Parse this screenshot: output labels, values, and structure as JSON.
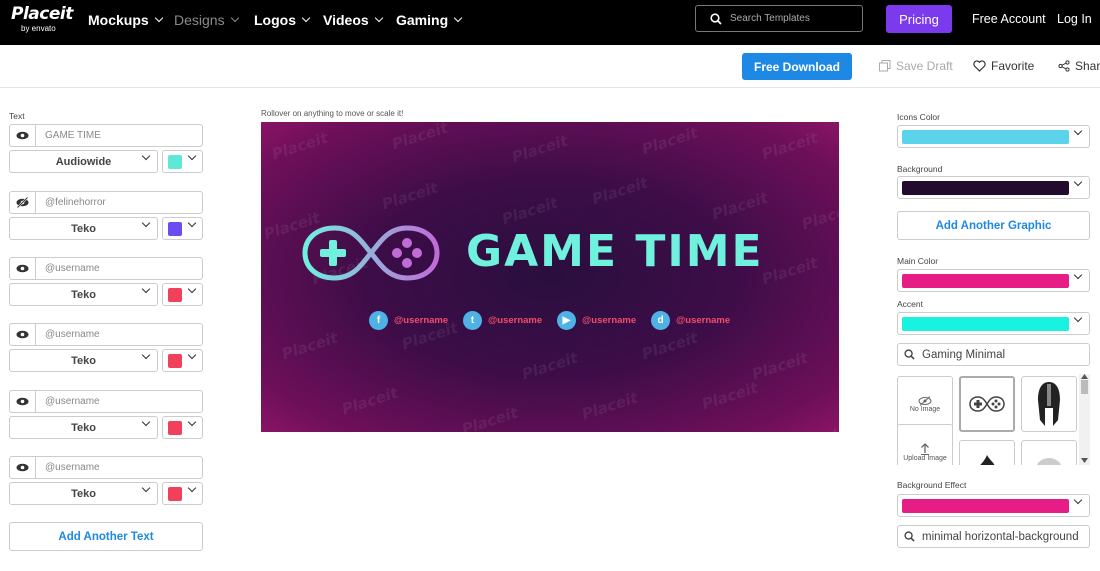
{
  "nav": {
    "logo_main": "Placeit",
    "logo_sub": "by envato",
    "items": [
      {
        "label": "Mockups",
        "dim": false
      },
      {
        "label": "Designs",
        "dim": true
      },
      {
        "label": "Logos",
        "dim": false
      },
      {
        "label": "Videos",
        "dim": false
      },
      {
        "label": "Gaming",
        "dim": false
      }
    ],
    "search_placeholder": "Search Templates",
    "pricing": "Pricing",
    "free_account": "Free Account",
    "login": "Log In"
  },
  "toolbar": {
    "free_download": "Free Download",
    "save_draft": "Save Draft",
    "favorite": "Favorite",
    "share": "Share"
  },
  "left": {
    "section_label": "Text",
    "text_fields": [
      {
        "value": "GAME TIME",
        "font": "Audiowide",
        "color": "#5fe8d5",
        "visible": true
      },
      {
        "value": "@felinehorror",
        "font": "Teko",
        "color": "#6c4cf0",
        "visible": false
      },
      {
        "value": "@username",
        "font": "Teko",
        "color": "#f0405a",
        "visible": true
      },
      {
        "value": "@username",
        "font": "Teko",
        "color": "#f0405a",
        "visible": true
      },
      {
        "value": "@username",
        "font": "Teko",
        "color": "#f0405a",
        "visible": true
      },
      {
        "value": "@username",
        "font": "Teko",
        "color": "#f0405a",
        "visible": true
      }
    ],
    "add_text": "Add Another Text"
  },
  "canvas": {
    "hint": "Rollover on anything to move or scale it!",
    "watermark": "Placeit",
    "title": "GAME TIME",
    "socials": [
      {
        "icon": "facebook-icon",
        "glyph": "f",
        "handle": "@username"
      },
      {
        "icon": "twitter-icon",
        "glyph": "t",
        "handle": "@username"
      },
      {
        "icon": "youtube-icon",
        "glyph": "▶",
        "handle": "@username"
      },
      {
        "icon": "discord-icon",
        "glyph": "d",
        "handle": "@username"
      }
    ]
  },
  "right": {
    "icons_color_label": "Icons Color",
    "icons_color": "#5bd3ea",
    "background_label": "Background",
    "background_color": "#230b2e",
    "add_graphic": "Add Another Graphic",
    "main_color_label": "Main Color",
    "main_color": "#e51d84",
    "accent_label": "Accent",
    "accent_color": "#19f2e0",
    "graphic_search": "Gaming Minimal",
    "no_image": "No Image",
    "upload": "Upload Image",
    "bg_effect_label": "Background Effect",
    "bg_effect_color": "#e51d84",
    "bg_search": "minimal horizontal-background"
  }
}
